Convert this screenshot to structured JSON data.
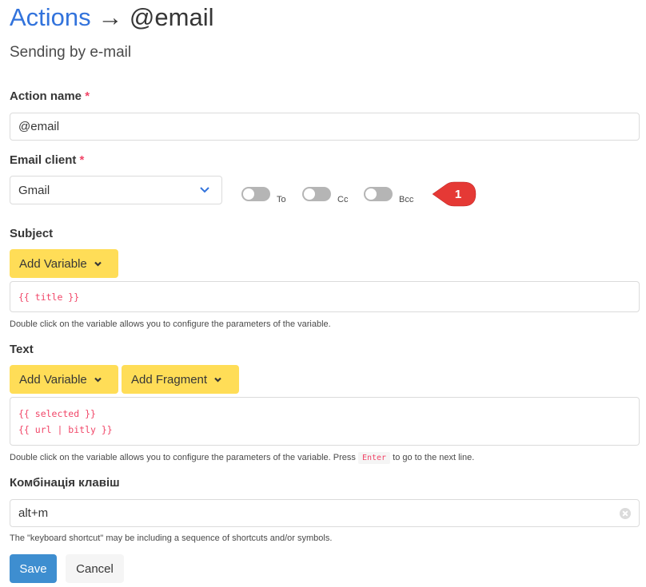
{
  "header": {
    "breadcrumb_link": "Actions",
    "arrow": "→",
    "current": "@email",
    "subtitle": "Sending by e-mail"
  },
  "form": {
    "action_name": {
      "label": "Action name",
      "required_mark": "*",
      "value": "@email"
    },
    "email_client": {
      "label": "Email client",
      "required_mark": "*",
      "selected": "Gmail",
      "toggles": [
        {
          "label": "To",
          "on": false
        },
        {
          "label": "Cc",
          "on": false
        },
        {
          "label": "Bcc",
          "on": false
        }
      ],
      "callout_number": "1",
      "callout_color": "#e53935"
    },
    "subject": {
      "label": "Subject",
      "add_variable_label": "Add Variable",
      "value_lines": [
        "{{ title }}"
      ],
      "help": "Double click on the variable allows you to configure the parameters of the variable."
    },
    "text": {
      "label": "Text",
      "add_variable_label": "Add Variable",
      "add_fragment_label": "Add Fragment",
      "value_lines": [
        "{{ selected }}",
        "{{ url | bitly }}"
      ],
      "help_before": "Double click on the variable allows you to configure the parameters of the variable. Press",
      "help_key": "Enter",
      "help_after": "to go to the next line."
    },
    "shortcut": {
      "label": "Комбінація клавіш",
      "value": "alt+m",
      "help": "The \"keyboard shortcut\" may be including a sequence of shortcuts and/or symbols."
    }
  },
  "buttons": {
    "save": "Save",
    "cancel": "Cancel"
  },
  "colors": {
    "link": "#3273dc",
    "primary": "#3e8ed0",
    "warning": "#ffdd57",
    "danger": "#f14668"
  }
}
